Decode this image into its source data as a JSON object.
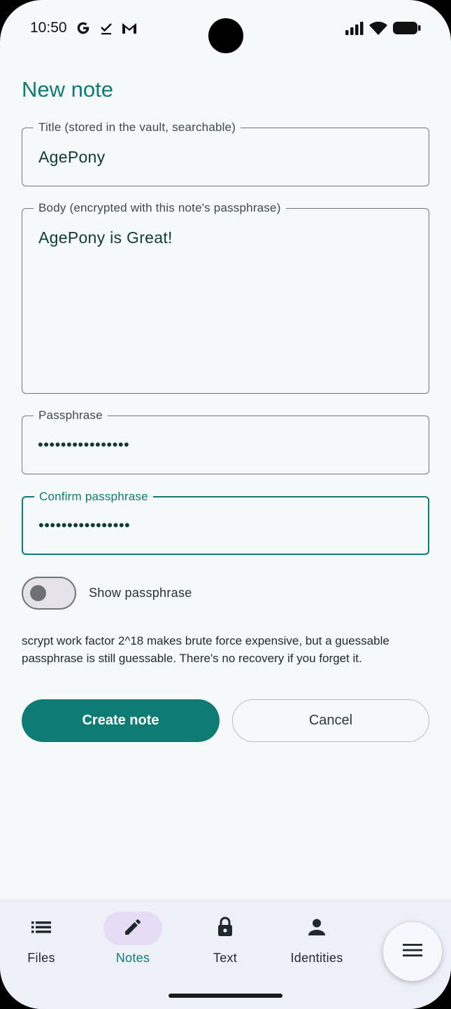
{
  "status_bar": {
    "time": "10:50",
    "icons_left": [
      "google-icon",
      "check-icon",
      "gmail-icon"
    ],
    "icons_right": [
      "signal-icon",
      "wifi-icon",
      "battery-icon"
    ]
  },
  "page": {
    "title": "New note"
  },
  "form": {
    "title_field": {
      "label": "Title (stored in the vault, searchable)",
      "value": "AgePony"
    },
    "body_field": {
      "label": "Body (encrypted with this note's passphrase)",
      "value": "AgePony is Great!"
    },
    "passphrase_field": {
      "label": "Passphrase",
      "value": "••••••••••••••••"
    },
    "confirm_field": {
      "label": "Confirm passphrase",
      "value": "••••••••••••••••"
    },
    "show_toggle": {
      "label": "Show passphrase",
      "on": false
    },
    "warning": "scrypt work factor 2^18 makes brute force expensive, but a guessable passphrase is still guessable. There's no recovery if you forget it.",
    "create_label": "Create note",
    "cancel_label": "Cancel"
  },
  "nav": {
    "items": [
      {
        "label": "Files",
        "icon": "list-icon"
      },
      {
        "label": "Notes",
        "icon": "pencil-icon",
        "active": true
      },
      {
        "label": "Text",
        "icon": "lock-icon"
      },
      {
        "label": "Identities",
        "icon": "person-icon"
      }
    ],
    "fab_icon": "menu-icon"
  },
  "colors": {
    "accent": "#0e7c74",
    "background": "#f5f9f9",
    "nav_bg": "#eef0f8",
    "active_pill": "#e6dcf5"
  }
}
